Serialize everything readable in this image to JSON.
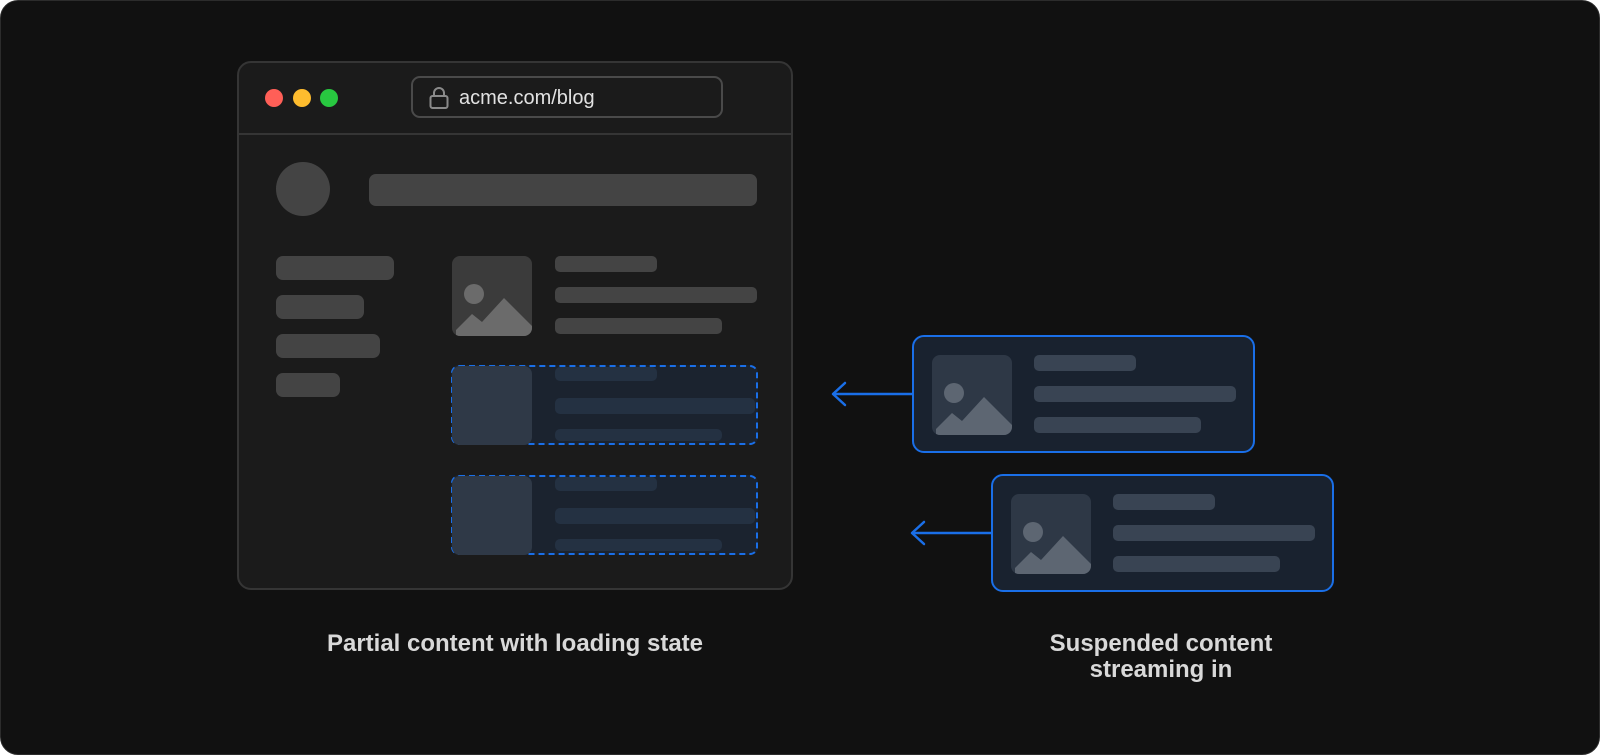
{
  "browser": {
    "url": "acme.com/blog"
  },
  "captions": {
    "left": "Partial content with loading state",
    "right_line1": "Suspended content",
    "right_line2": "streaming in"
  },
  "colors": {
    "accent": "#1a6fe8",
    "background": "#111111",
    "skeleton": "#444444",
    "traffic_red": "#ff5f57",
    "traffic_yellow": "#febc2e",
    "traffic_green": "#28c840"
  },
  "icons": [
    "lock-icon",
    "image-placeholder-icon",
    "arrow-left-icon"
  ]
}
